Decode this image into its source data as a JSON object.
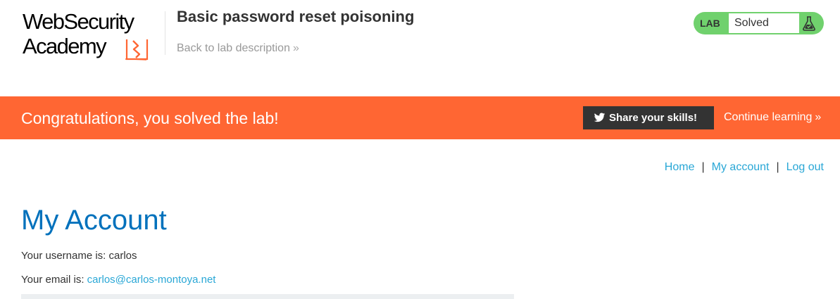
{
  "header": {
    "logo": {
      "line1": "WebSecurity",
      "line2": "Academy",
      "accent_color": "#ff6633"
    },
    "lab_title": "Basic password reset poisoning",
    "back_link": "Back to lab description",
    "back_chevron": "»",
    "lab_status": {
      "label": "LAB",
      "status": "Solved",
      "color": "#70d16d",
      "icon": "flask-icon"
    }
  },
  "banner": {
    "message": "Congratulations, you solved the lab!",
    "share_button": "Share your skills!",
    "share_icon": "twitter-icon",
    "continue_link": "Continue learning",
    "continue_chevron": "»",
    "color": "#ff6633"
  },
  "nav": {
    "home": "Home",
    "separator": "|",
    "my_account": "My account",
    "log_out": "Log out",
    "link_color": "#29a7d6"
  },
  "main": {
    "heading": "My Account",
    "heading_color": "#0071bc",
    "username_label": "Your username is: carlos",
    "email_label": "Your email is: ",
    "email_value": "carlos@carlos-montoya.net"
  }
}
